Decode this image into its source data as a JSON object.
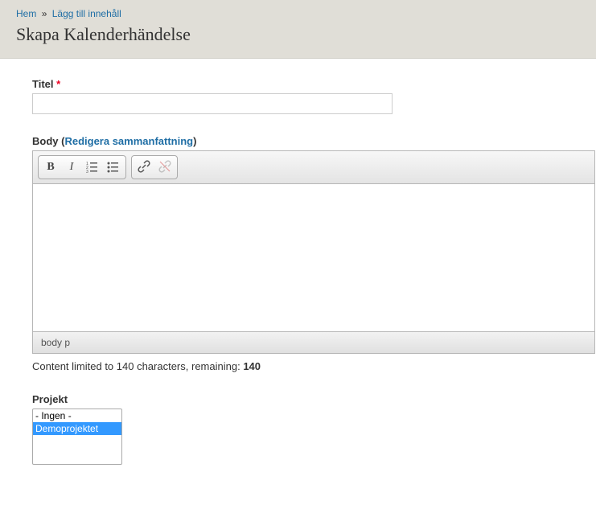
{
  "breadcrumb": {
    "home": "Hem",
    "sep": "»",
    "add": "Lägg till innehåll"
  },
  "page_title": "Skapa Kalenderhändelse",
  "title_field": {
    "label": "Titel",
    "required_mark": "*",
    "value": ""
  },
  "body_field": {
    "label_prefix": "Body (",
    "link_text": "Redigera sammanfattning",
    "label_suffix": ")",
    "content": "",
    "status_path": "body p",
    "char_limit_prefix": "Content limited to 140 characters, remaining: ",
    "char_remaining": "140"
  },
  "project_field": {
    "label": "Projekt",
    "options": [
      {
        "label": "- Ingen -",
        "selected": false
      },
      {
        "label": "Demoprojektet",
        "selected": true
      }
    ]
  },
  "icons": {
    "bold": "B",
    "italic": "I"
  }
}
